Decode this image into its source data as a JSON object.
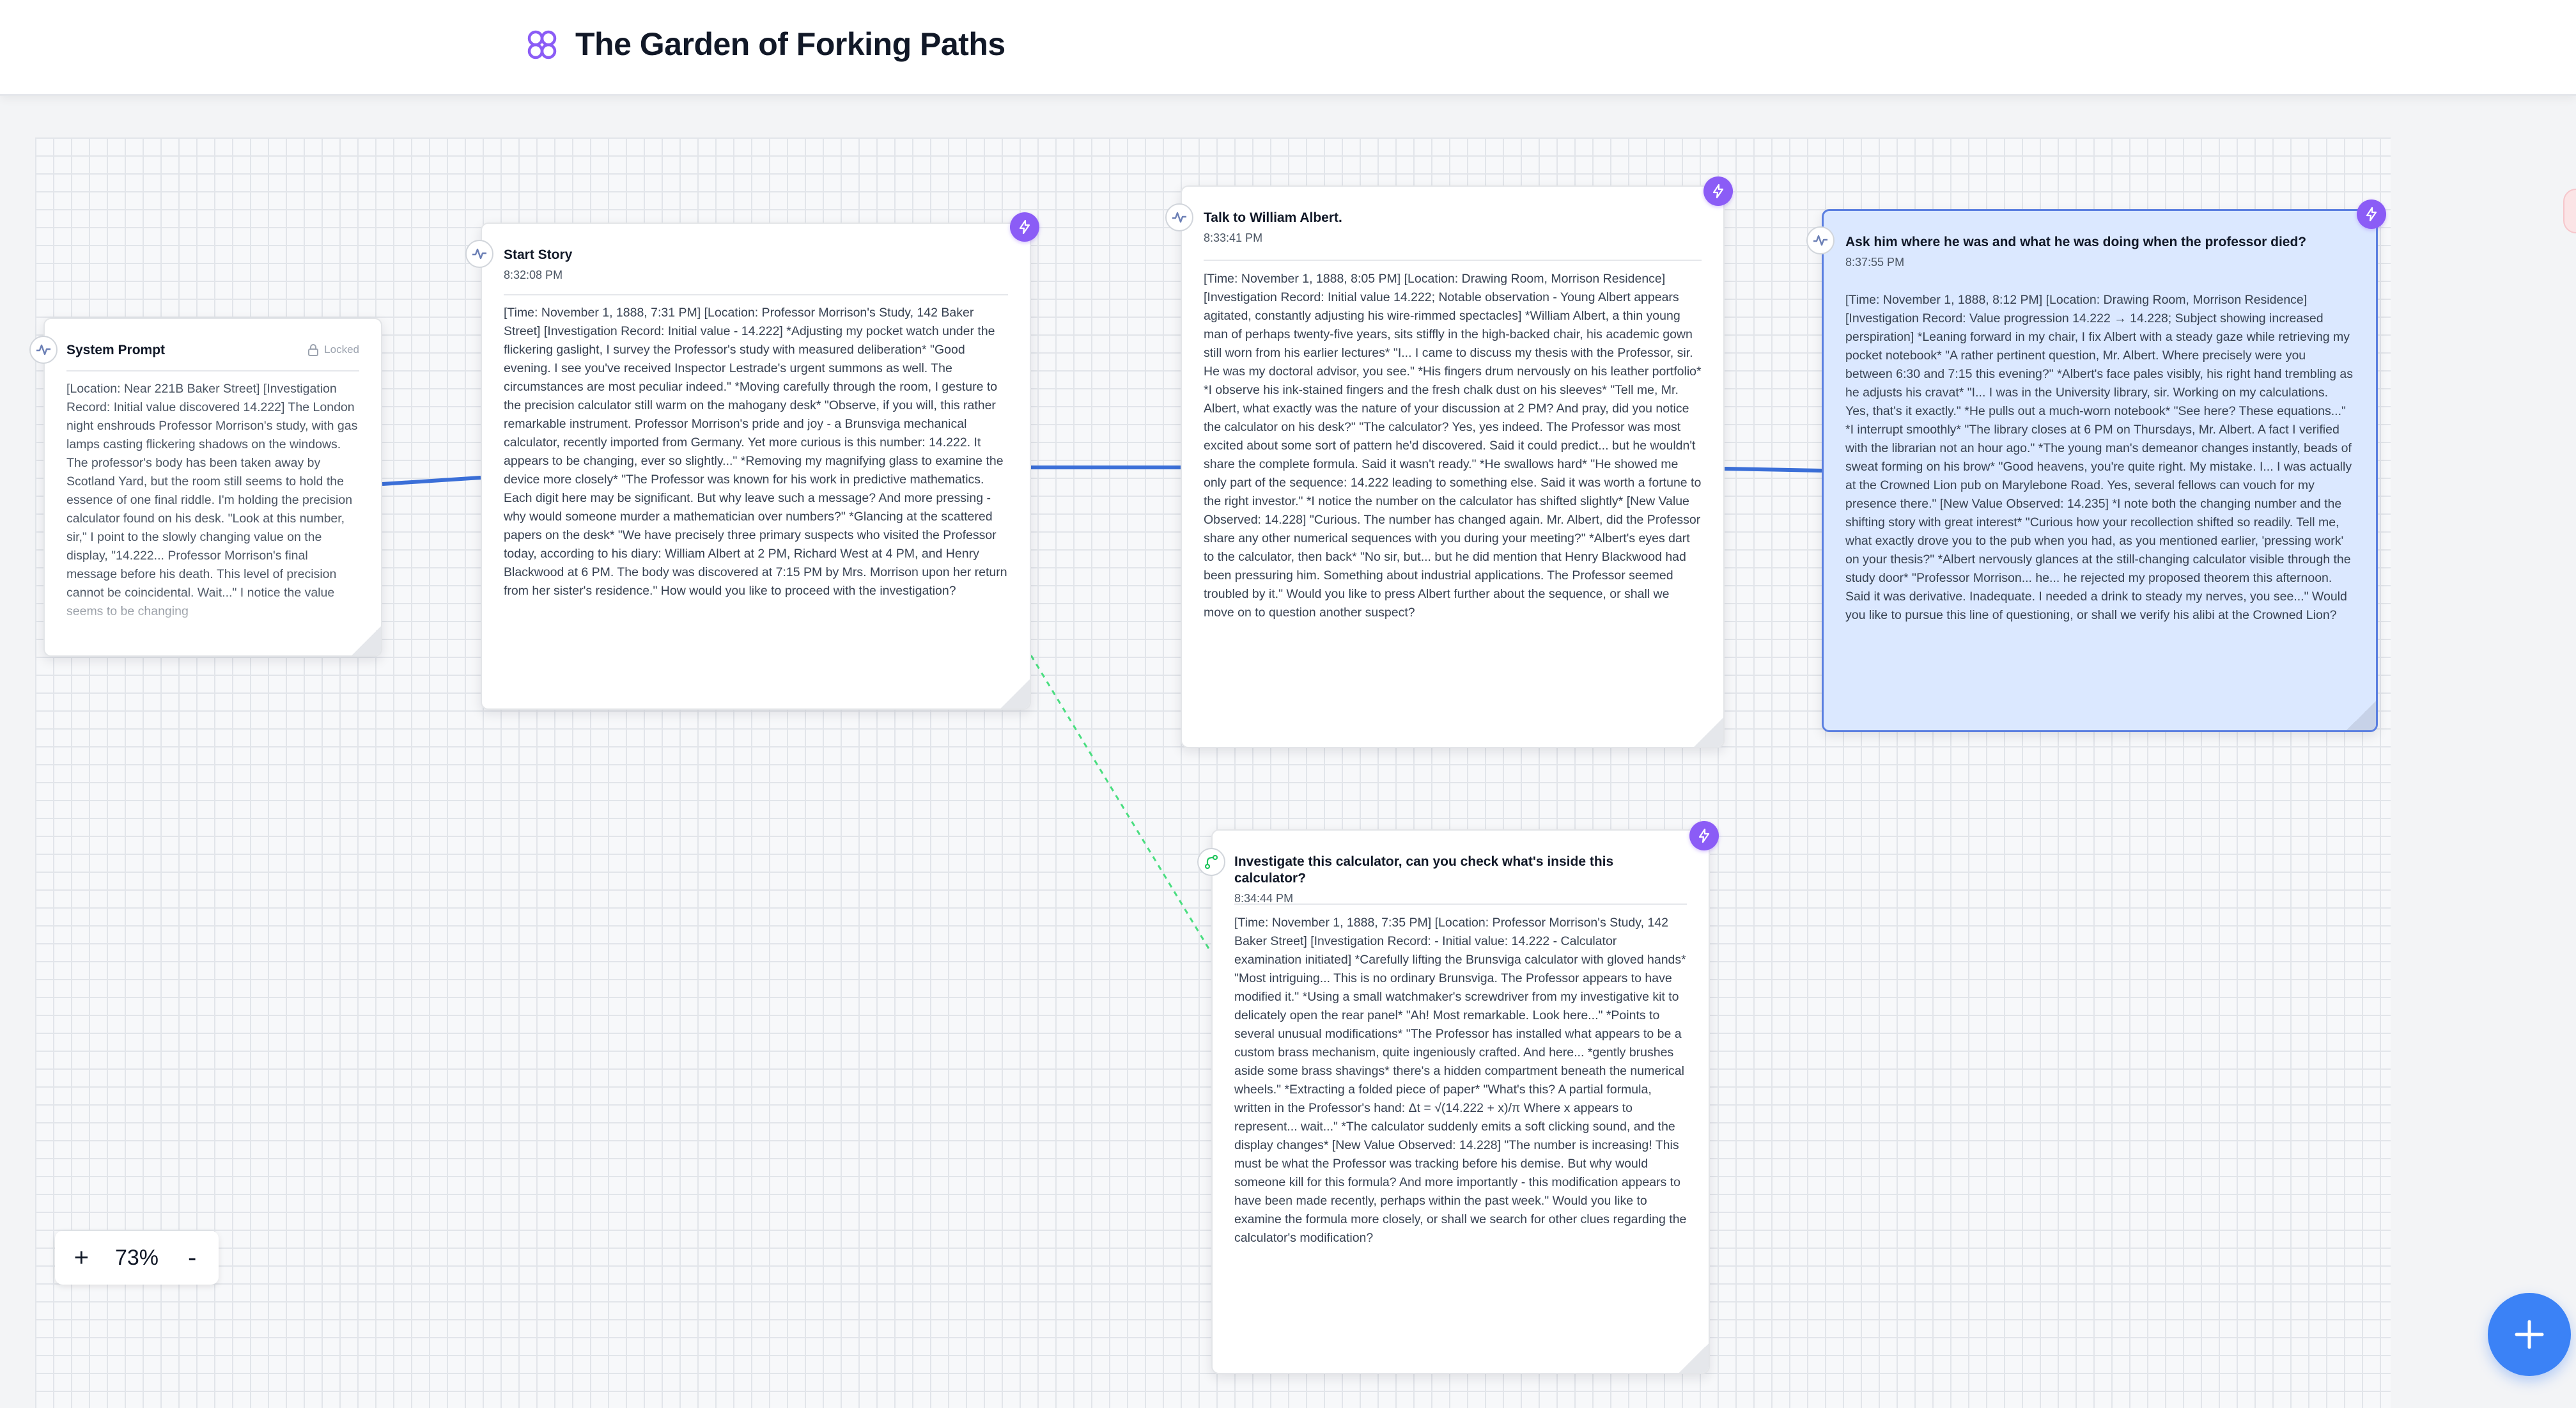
{
  "app": {
    "title": "The Garden of Forking Paths"
  },
  "colors": {
    "accent": "#8b5cf6",
    "edge": "#3b6fd8",
    "branch_edge": "#4ade80",
    "fab": "#3b82f6",
    "selected_bg": "#dbe8ff"
  },
  "zoom": {
    "plus": "+",
    "level": "73%",
    "minus": "-"
  },
  "fab": {
    "icon": "plus-icon"
  },
  "nodes": {
    "system": {
      "title": "System Prompt",
      "locked": "Locked",
      "body": "[Location: Near 221B Baker Street] [Investigation Record: Initial value discovered 14.222] The London night enshrouds Professor Morrison's study, with gas lamps casting flickering shadows on the windows. The professor's body has been taken away by Scotland Yard, but the room still seems to hold the essence of one final riddle. I'm holding the precision calculator found on his desk. \"Look at this number, sir,\" I point to the slowly changing value on the display, \"14.222... Professor Morrison's final message before his death. This level of precision cannot be coincidental. Wait...\" I notice the value seems to be changing"
    },
    "start": {
      "title": "Start Story",
      "time": "8:32:08 PM",
      "body": "[Time: November 1, 1888, 7:31 PM] [Location: Professor Morrison's Study, 142 Baker Street] [Investigation Record: Initial value - 14.222] *Adjusting my pocket watch under the flickering gaslight, I survey the Professor's study with measured deliberation* \"Good evening. I see you've received Inspector Lestrade's urgent summons as well. The circumstances are most peculiar indeed.\" *Moving carefully through the room, I gesture to the precision calculator still warm on the mahogany desk* \"Observe, if you will, this rather remarkable instrument. Professor Morrison's pride and joy - a Brunsviga mechanical calculator, recently imported from Germany. Yet more curious is this number: 14.222. It appears to be changing, ever so slightly...\" *Removing my magnifying glass to examine the device more closely* \"The Professor was known for his work in predictive mathematics. Each digit here may be significant. But why leave such a message? And more pressing - why would someone murder a mathematician over numbers?\" *Glancing at the scattered papers on the desk* \"We have precisely three primary suspects who visited the Professor today, according to his diary: William Albert at 2 PM, Richard West at 4 PM, and Henry Blackwood at 6 PM. The body was discovered at 7:15 PM by Mrs. Morrison upon her return from her sister's residence.\" How would you like to proceed with the investigation?"
    },
    "albert": {
      "title": "Talk to William Albert.",
      "time": "8:33:41 PM",
      "body": "[Time: November 1, 1888, 8:05 PM] [Location: Drawing Room, Morrison Residence] [Investigation Record: Initial value 14.222; Notable observation - Young Albert appears agitated, constantly adjusting his wire-rimmed spectacles] *William Albert, a thin young man of perhaps twenty-five years, sits stiffly in the high-backed chair, his academic gown still worn from his earlier lectures* \"I... I came to discuss my thesis with the Professor, sir. He was my doctoral advisor, you see.\" *His fingers drum nervously on his leather portfolio* *I observe his ink-stained fingers and the fresh chalk dust on his sleeves* \"Tell me, Mr. Albert, what exactly was the nature of your discussion at 2 PM? And pray, did you notice the calculator on his desk?\" \"The calculator? Yes, yes indeed. The Professor was most excited about some sort of pattern he'd discovered. Said it could predict... but he wouldn't share the complete formula. Said it wasn't ready.\" *He swallows hard* \"He showed me only part of the sequence: 14.222 leading to something else. Said it was worth a fortune to the right investor.\" *I notice the number on the calculator has shifted slightly* [New Value Observed: 14.228] \"Curious. The number has changed again. Mr. Albert, did the Professor share any other numerical sequences with you during your meeting?\" *Albert's eyes dart to the calculator, then back* \"No sir, but... but he did mention that Henry Blackwood had been pressuring him. Something about industrial applications. The Professor seemed troubled by it.\" Would you like to press Albert further about the sequence, or shall we move on to question another suspect?"
    },
    "whereabouts": {
      "title": "Ask him where he was and what he was doing when the professor died?",
      "time": "8:37:55 PM",
      "body": "[Time: November 1, 1888, 8:12 PM] [Location: Drawing Room, Morrison Residence] [Investigation Record: Value progression 14.222 → 14.228; Subject showing increased perspiration] *Leaning forward in my chair, I fix Albert with a steady gaze while retrieving my pocket notebook* \"A rather pertinent question, Mr. Albert. Where precisely were you between 6:30 and 7:15 this evening?\" *Albert's face pales visibly, his right hand trembling as he adjusts his cravat* \"I... I was in the University library, sir. Working on my calculations. Yes, that's it exactly.\" *He pulls out a much-worn notebook* \"See here? These equations...\" *I interrupt smoothly* \"The library closes at 6 PM on Thursdays, Mr. Albert. A fact I verified with the librarian not an hour ago.\" *The young man's demeanor changes instantly, beads of sweat forming on his brow* \"Good heavens, you're quite right. My mistake. I... I was actually at the Crowned Lion pub on Marylebone Road. Yes, several fellows can vouch for my presence there.\" [New Value Observed: 14.235] *I note both the changing number and the shifting story with great interest* \"Curious how your recollection shifted so readily. Tell me, what exactly drove you to the pub when you had, as you mentioned earlier, 'pressing work' on your thesis?\" *Albert nervously glances at the still-changing calculator visible through the study door* \"Professor Morrison... he... he rejected my proposed theorem this afternoon. Said it was derivative. Inadequate. I needed a drink to steady my nerves, you see...\" Would you like to pursue this line of questioning, or shall we verify his alibi at the Crowned Lion?"
    },
    "calculator": {
      "title": "Investigate this calculator, can you check what's inside this calculator?",
      "time": "8:34:44 PM",
      "body": "[Time: November 1, 1888, 7:35 PM] [Location: Professor Morrison's Study, 142 Baker Street] [Investigation Record: - Initial value: 14.222 - Calculator examination initiated] *Carefully lifting the Brunsviga calculator with gloved hands* \"Most intriguing... This is no ordinary Brunsviga. The Professor appears to have modified it.\" *Using a small watchmaker's screwdriver from my investigative kit to delicately open the rear panel* \"Ah! Most remarkable. Look here...\" *Points to several unusual modifications* \"The Professor has installed what appears to be a custom brass mechanism, quite ingeniously crafted. And here... *gently brushes aside some brass shavings* there's a hidden compartment beneath the numerical wheels.\" *Extracting a folded piece of paper* \"What's this? A partial formula, written in the Professor's hand: Δt = √(14.222 + x)/π Where x appears to represent... wait...\" *The calculator suddenly emits a soft clicking sound, and the display changes* [New Value Observed: 14.228] \"The number is increasing! This must be what the Professor was tracking before his demise. But why would someone kill for this formula? And more importantly - this modification appears to have been made recently, perhaps within the past week.\" Would you like to examine the formula more closely, or shall we search for other clues regarding the calculator's modification?"
    }
  }
}
